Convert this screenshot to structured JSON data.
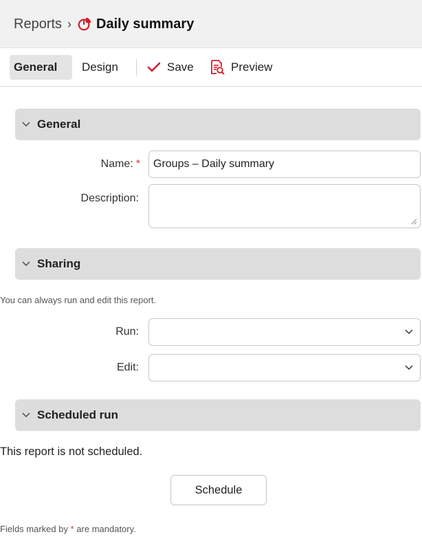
{
  "breadcrumb": {
    "root": "Reports",
    "separator": "›",
    "title": "Daily summary",
    "title_icon": "report-pie-icon"
  },
  "toolbar": {
    "general_label": "General",
    "design_label": "Design",
    "save_label": "Save",
    "save_icon": "checkmark-icon",
    "preview_label": "Preview",
    "preview_icon": "preview-document-icon"
  },
  "sections": {
    "general": {
      "title": "General"
    },
    "sharing": {
      "title": "Sharing"
    },
    "scheduled": {
      "title": "Scheduled run"
    }
  },
  "general_form": {
    "name_label": "Name:",
    "name_value": "Groups – Daily summary",
    "required_marker": "*",
    "description_label": "Description:",
    "description_value": ""
  },
  "sharing_form": {
    "hint": "You can always run and edit this report.",
    "run_label": "Run:",
    "run_value": "",
    "edit_label": "Edit:",
    "edit_value": ""
  },
  "scheduled_form": {
    "status_text": "This report is not scheduled.",
    "schedule_button": "Schedule"
  },
  "footer": {
    "note_prefix": "Fields marked by",
    "note_marker": "*",
    "note_suffix": "are mandatory."
  },
  "colors": {
    "accent_red": "#d21e2b",
    "required_red": "#d63a3a",
    "section_bg": "#dddddd",
    "header_bg": "#f1f1f1"
  }
}
